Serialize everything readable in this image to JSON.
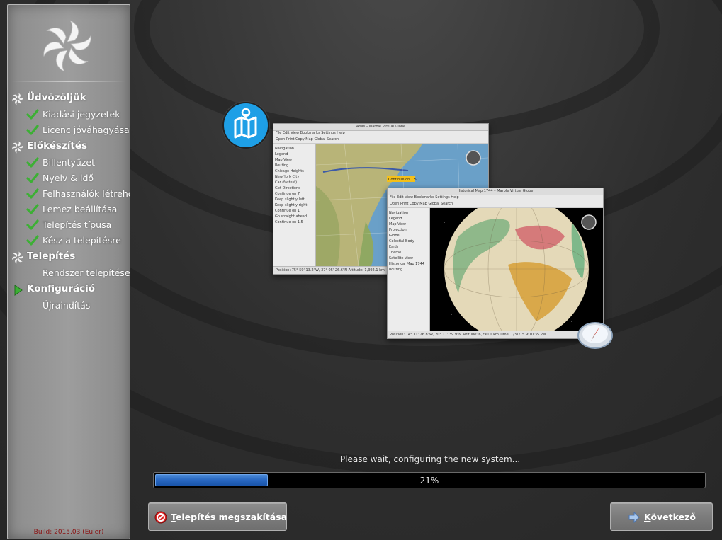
{
  "sidebar": {
    "logo_icon": "distro-swirl-logo",
    "build": "Build: 2015.03 (Euler)",
    "steps": [
      {
        "label": "Üdvözöljük",
        "kind": "section",
        "state": "section"
      },
      {
        "label": "Kiadási jegyzetek",
        "kind": "sub",
        "state": "done"
      },
      {
        "label": "Licenc jóváhagyása",
        "kind": "sub",
        "state": "done"
      },
      {
        "label": "Előkészítés",
        "kind": "section",
        "state": "section"
      },
      {
        "label": "Billentyűzet",
        "kind": "sub",
        "state": "done"
      },
      {
        "label": "Nyelv & idő",
        "kind": "sub",
        "state": "done"
      },
      {
        "label": "Felhasználók létrehozása",
        "kind": "sub",
        "state": "done"
      },
      {
        "label": "Lemez beállítása",
        "kind": "sub",
        "state": "done"
      },
      {
        "label": "Telepítés típusa",
        "kind": "sub",
        "state": "done"
      },
      {
        "label": "Kész a telepítésre",
        "kind": "sub",
        "state": "done"
      },
      {
        "label": "Telepítés",
        "kind": "section",
        "state": "section"
      },
      {
        "label": "Rendszer telepítése",
        "kind": "sub",
        "state": "none"
      },
      {
        "label": "Konfiguráció",
        "kind": "section",
        "state": "current"
      },
      {
        "label": "Újraindítás",
        "kind": "sub",
        "state": "none"
      }
    ]
  },
  "slideshow": {
    "badge_icon": "map-icon",
    "compass_icon": "compass-icon",
    "win1": {
      "title": "Atlas – Marble Virtual Globe",
      "menu": "File  Edit  View  Bookmarks  Settings  Help",
      "toolbar": "Open   Print   Copy Map   Global Search",
      "panel": [
        "Navigation",
        "Legend",
        "Map View",
        "Routing",
        "Chicago Heights",
        "New York City",
        "Car (fastest)",
        "Get Directions",
        "Continue on 7",
        "Keep slightly left",
        "Keep slightly right",
        "Continue on 1",
        "Go straight ahead",
        "Continue on 1.5"
      ],
      "status": "Position:  75° 59' 13.2\"W,  37° 05' 26.6\"N      Altitude:  1,392.1 km",
      "callout": "Continue on 1.5"
    },
    "win2": {
      "title": "Historical Map 1744 – Marble Virtual Globe",
      "menu": "File  Edit  View  Bookmarks  Settings  Help",
      "toolbar": "Open   Print   Copy Map   Global Search",
      "panel": [
        "Navigation",
        "Legend",
        "Map View",
        "Projection",
        "Globe",
        "Celestial Body",
        "Earth",
        "Theme",
        "Satellite View",
        "Historical Map 1744",
        "Routing"
      ],
      "status": "Position:  14° 31' 26.8\"W,  20° 11' 39.9\"N      Altitude:  6,290.0 km      Time: 1/31/15 9:10:35 PM"
    }
  },
  "progress": {
    "message": "Please wait, configuring the new system...",
    "value": 0.21,
    "label": "21%"
  },
  "buttons": {
    "cancel": {
      "label": "Telepítés megszakítása",
      "icon": "cancel-icon"
    },
    "next": {
      "label": "Következő",
      "icon": "arrow-right-icon"
    }
  },
  "colors": {
    "progress_fill": "#2766c0",
    "check": "#3cb034",
    "current_arrow": "#3cb034",
    "build_text": "#8a1010",
    "map_badge": "#1e9fe6"
  }
}
